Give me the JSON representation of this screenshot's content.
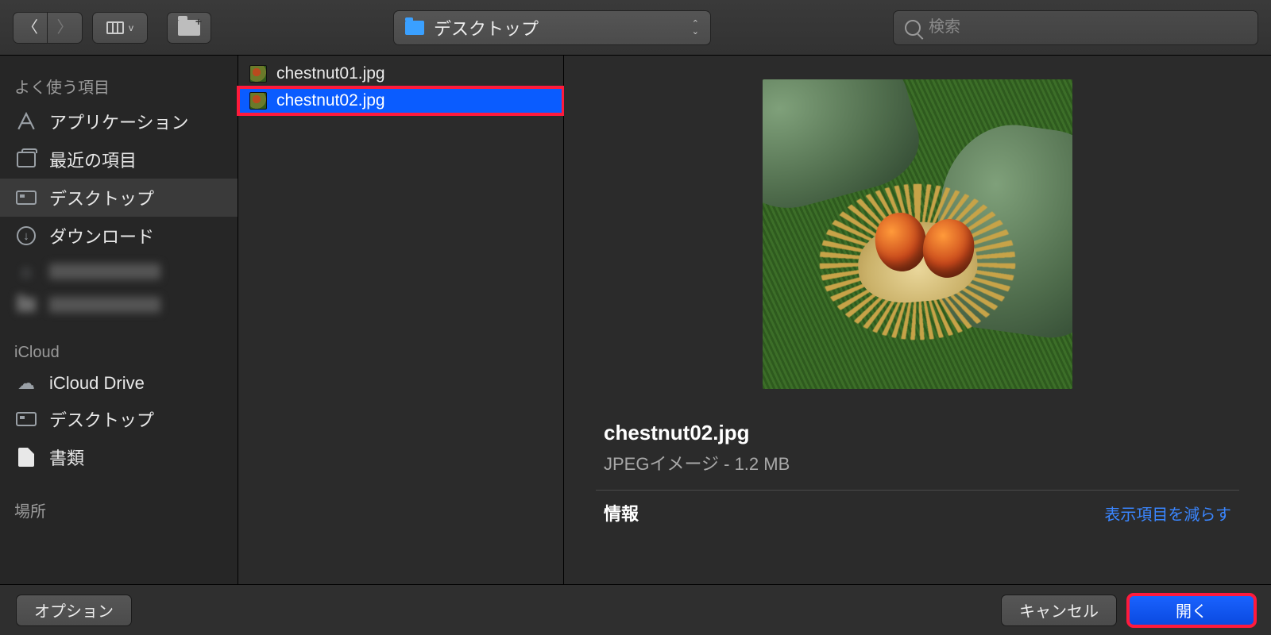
{
  "toolbar": {
    "location_label": "デスクトップ",
    "search_placeholder": "検索"
  },
  "sidebar": {
    "section_favorites": "よく使う項目",
    "section_icloud": "iCloud",
    "section_locations": "場所",
    "items": {
      "applications": "アプリケーション",
      "recents": "最近の項目",
      "desktop": "デスクトップ",
      "downloads": "ダウンロード",
      "icloud_drive": "iCloud Drive",
      "icloud_desktop": "デスクトップ",
      "documents": "書類"
    }
  },
  "files": {
    "0": {
      "name": "chestnut01.jpg"
    },
    "1": {
      "name": "chestnut02.jpg"
    }
  },
  "preview": {
    "filename": "chestnut02.jpg",
    "subtitle": "JPEGイメージ - 1.2 MB",
    "info_label": "情報",
    "reduce_link": "表示項目を減らす"
  },
  "footer": {
    "options": "オプション",
    "cancel": "キャンセル",
    "open": "開く"
  }
}
